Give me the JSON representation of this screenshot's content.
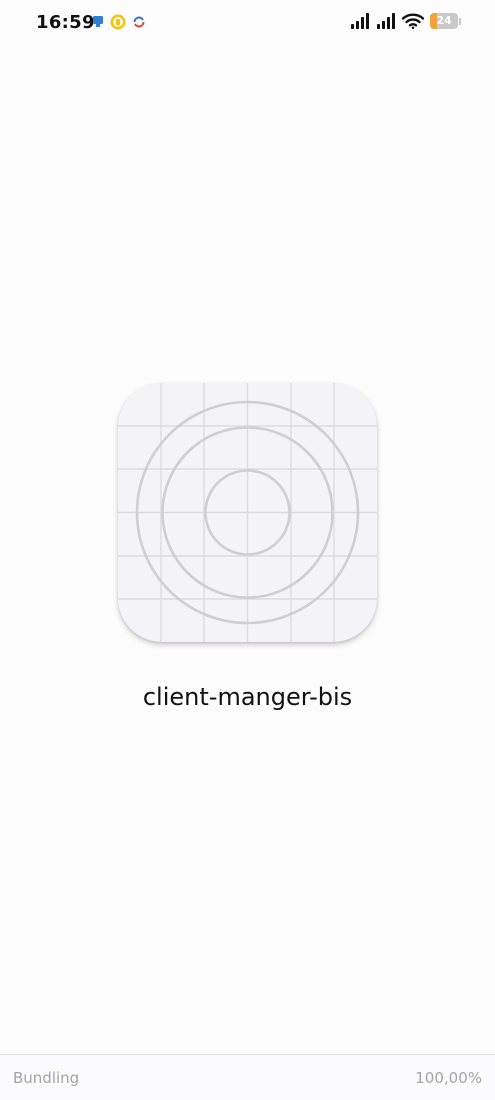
{
  "status_bar": {
    "time": "16:59",
    "notification_icons": [
      "message-icon",
      "coin-icon",
      "sync-icon"
    ],
    "system_icons": [
      "signal-icon",
      "signal-icon",
      "wifi-icon"
    ],
    "battery_level": "24",
    "battery_fraction": 0.24,
    "battery_color": "#f1a33a"
  },
  "app": {
    "name": "client-manger-bis",
    "icon": "app-placeholder-grid-icon"
  },
  "loading": {
    "label": "Bundling",
    "percent": "100,00%"
  }
}
